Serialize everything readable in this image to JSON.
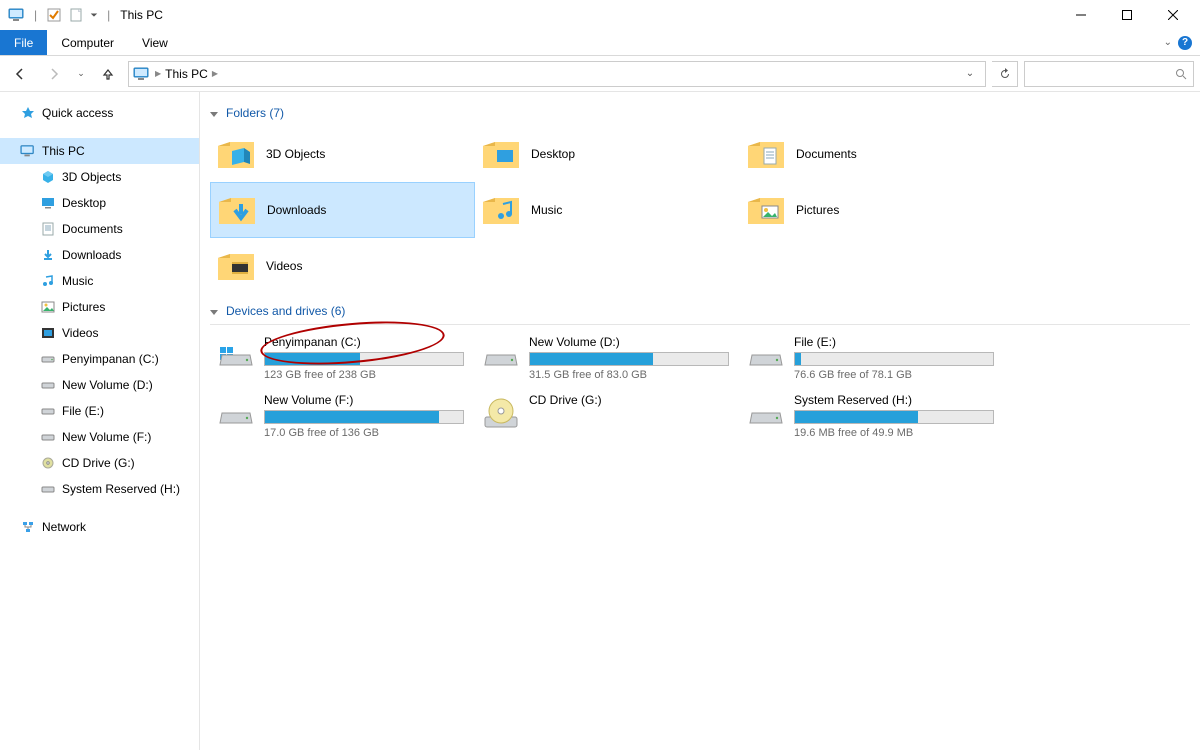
{
  "window": {
    "title": "This PC"
  },
  "ribbon": {
    "tabs": {
      "file": "File",
      "computer": "Computer",
      "view": "View"
    }
  },
  "address": {
    "location": "This PC",
    "search_placeholder": ""
  },
  "sidebar": {
    "quick_access": "Quick access",
    "this_pc": "This PC",
    "items": [
      {
        "label": "3D Objects"
      },
      {
        "label": "Desktop"
      },
      {
        "label": "Documents"
      },
      {
        "label": "Downloads"
      },
      {
        "label": "Music"
      },
      {
        "label": "Pictures"
      },
      {
        "label": "Videos"
      },
      {
        "label": "Penyimpanan (C:)"
      },
      {
        "label": "New Volume (D:)"
      },
      {
        "label": "File (E:)"
      },
      {
        "label": "New Volume (F:)"
      },
      {
        "label": "CD Drive (G:)"
      },
      {
        "label": "System Reserved (H:)"
      }
    ],
    "network": "Network"
  },
  "groups": {
    "folders": {
      "title": "Folders (7)"
    },
    "drives": {
      "title": "Devices and drives (6)"
    }
  },
  "folders": [
    {
      "label": "3D Objects"
    },
    {
      "label": "Desktop"
    },
    {
      "label": "Documents"
    },
    {
      "label": "Downloads"
    },
    {
      "label": "Music"
    },
    {
      "label": "Pictures"
    },
    {
      "label": "Videos"
    }
  ],
  "drives": [
    {
      "name": "Penyimpanan (C:)",
      "free": "123 GB free of 238 GB",
      "fill_pct": 48,
      "has_bar": true,
      "circled": true,
      "win": true
    },
    {
      "name": "New Volume (D:)",
      "free": "31.5 GB free of 83.0 GB",
      "fill_pct": 62,
      "has_bar": true
    },
    {
      "name": "File (E:)",
      "free": "76.6 GB free of 78.1 GB",
      "fill_pct": 3,
      "has_bar": true
    },
    {
      "name": "New Volume (F:)",
      "free": "17.0 GB free of 136 GB",
      "fill_pct": 88,
      "has_bar": true
    },
    {
      "name": "CD Drive (G:)",
      "free": "",
      "has_bar": false,
      "cd": true
    },
    {
      "name": "System Reserved (H:)",
      "free": "19.6 MB free of 49.9 MB",
      "fill_pct": 62,
      "has_bar": true
    }
  ]
}
